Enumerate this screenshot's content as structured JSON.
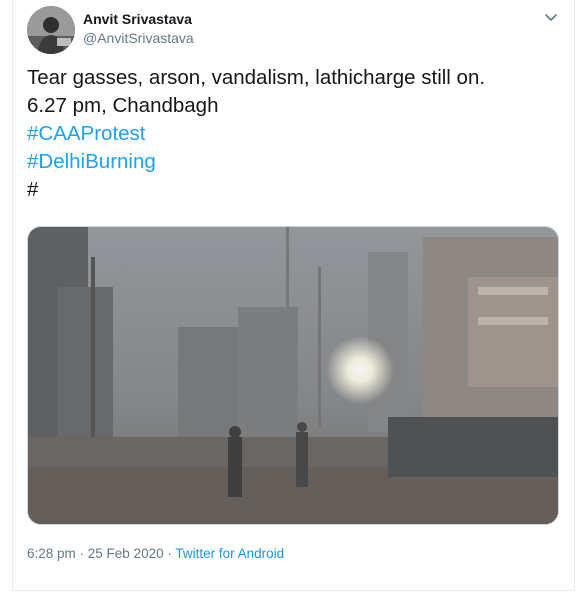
{
  "author": {
    "name": "Anvit Srivastava",
    "handle": "@AnvitSrivastava"
  },
  "tweet": {
    "line1": "Tear gasses, arson, vandalism, lathicharge still on.",
    "line2": "6.27 pm, Chandbagh",
    "hashtag1": "#CAAProtest",
    "hashtag2": "#DelhiBurning",
    "hashtag3": "#"
  },
  "meta": {
    "time": "6:28 pm",
    "separator1": " · ",
    "date": "25 Feb 2020",
    "separator2": " · ",
    "source": "Twitter for Android"
  },
  "icons": {
    "menu": "chevron-down-icon"
  },
  "colors": {
    "link": "#1da1f2",
    "muted": "#657786",
    "text": "#14171a"
  }
}
